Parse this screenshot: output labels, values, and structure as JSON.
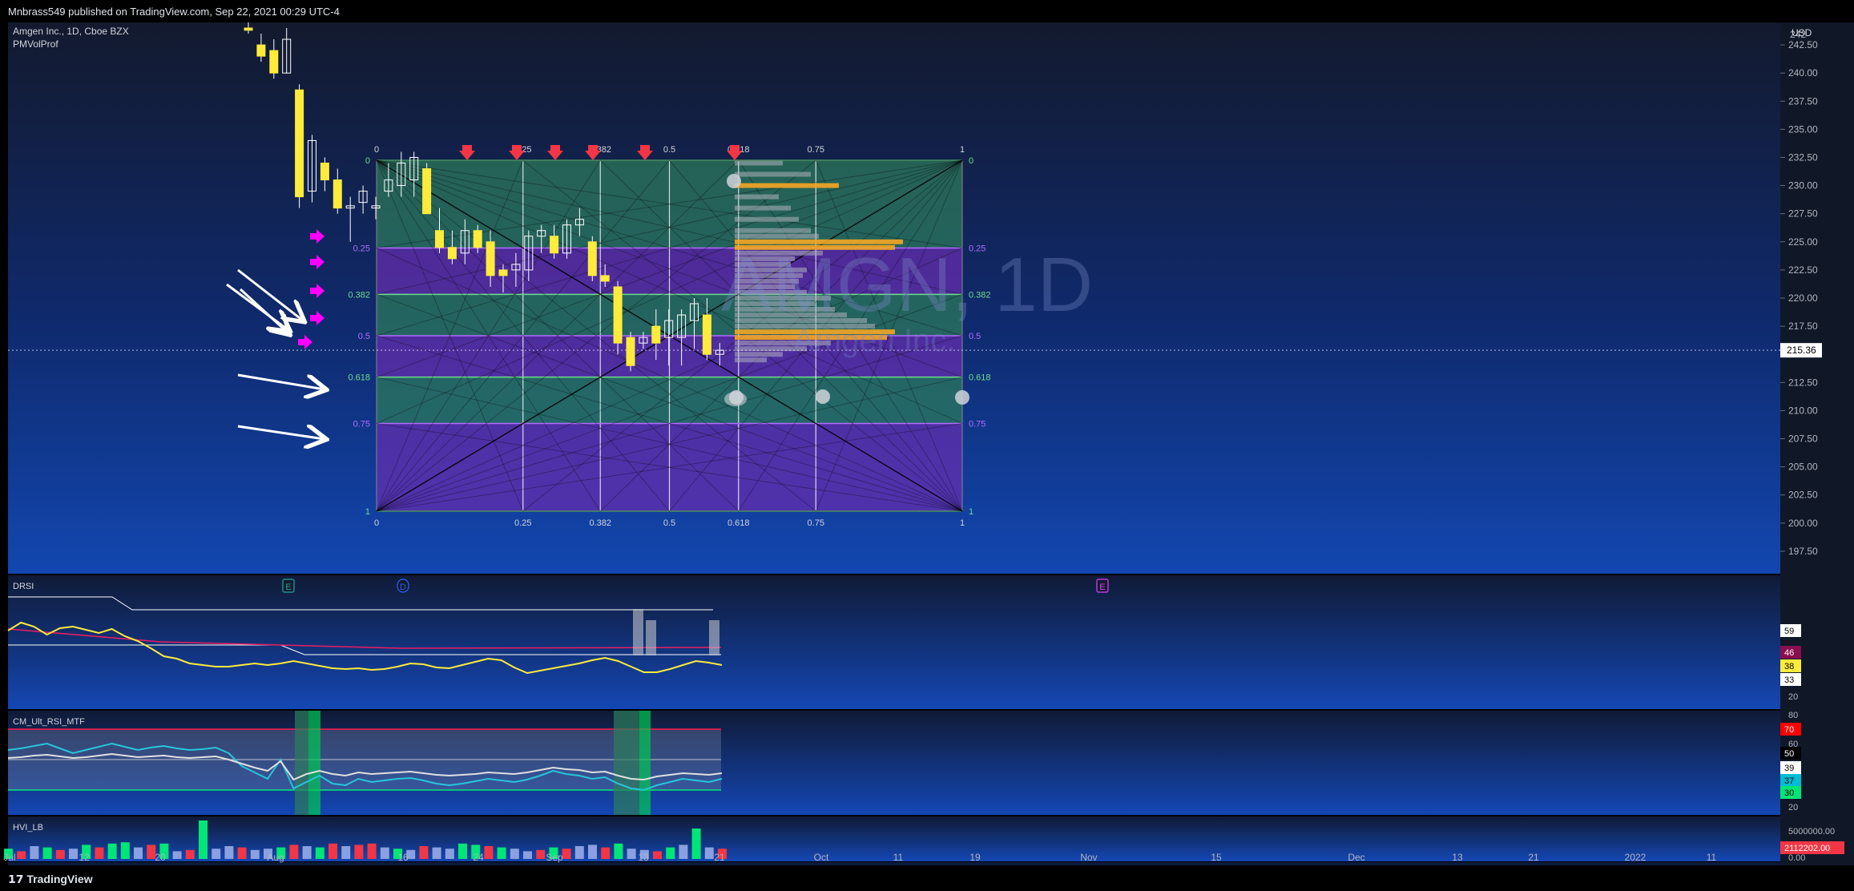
{
  "header": {
    "publish_line": "Mnbrass549 published on TradingView.com, Sep 22, 2021 00:29 UTC-4"
  },
  "symbol": {
    "name": "Amgen Inc., 1D, Cboe BZX",
    "indicator": "PMVolProf",
    "watermark": "AMGN, 1D",
    "watermark_sub": "Amgen Inc.",
    "currency": "USD"
  },
  "footer": {
    "brand": "TradingView"
  },
  "price_axis": {
    "ticks": [
      242.5,
      240.0,
      237.5,
      235.0,
      232.5,
      230.0,
      227.5,
      225.0,
      222.5,
      220.0,
      217.5,
      215.0,
      212.5,
      210.0,
      207.5,
      205.0,
      202.5,
      200.0,
      197.5
    ],
    "top_label": "242",
    "last_price": "215.36"
  },
  "time_axis": {
    "labels": [
      "Jul",
      "12",
      "20",
      "Aug",
      "16",
      "24",
      "Sep",
      "13",
      "21",
      "Oct",
      "11",
      "19",
      "Nov",
      "15",
      "Dec",
      "13",
      "21",
      "2022",
      "11"
    ]
  },
  "events": [
    {
      "label": "E",
      "color": "#26a69a"
    },
    {
      "label": "D",
      "color": "#2962ff"
    },
    {
      "label": "E",
      "color": "#e040fb"
    }
  ],
  "fib": {
    "top_labels": [
      "0",
      "0.25",
      "0.382",
      "0.5",
      "0.618",
      "0.75",
      "1"
    ],
    "bottom_labels": [
      "0",
      "0.25",
      "0.382",
      "0.5",
      "0.618",
      "0.75",
      "1"
    ],
    "left_labels": [
      "0",
      "0.25",
      "0.382",
      "0.5",
      "0.618",
      "0.75",
      "1"
    ],
    "right_labels": [
      "0",
      "0.25",
      "0.382",
      "0.5",
      "0.618",
      "0.75",
      "1"
    ]
  },
  "panes": {
    "drsi": {
      "title": "DRSI",
      "badges": [
        {
          "text": "59",
          "bg": "#ffffff",
          "fg": "#000"
        },
        {
          "text": "46",
          "bg": "#880e4f",
          "fg": "#fff"
        },
        {
          "text": "38",
          "bg": "#ffeb3b",
          "fg": "#000"
        },
        {
          "text": "33",
          "bg": "#ffffff",
          "fg": "#000"
        }
      ],
      "ticks": [
        "20"
      ]
    },
    "rsi": {
      "title": "CM_Ult_RSI_MTF",
      "badges": [
        {
          "text": "70",
          "bg": "#ff0000",
          "fg": "#fff"
        },
        {
          "text": "50",
          "bg": "#000000",
          "fg": "#fff"
        },
        {
          "text": "39",
          "bg": "#ffffff",
          "fg": "#000"
        },
        {
          "text": "37",
          "bg": "#00bcd4",
          "fg": "#000"
        },
        {
          "text": "30",
          "bg": "#00e676",
          "fg": "#000"
        }
      ],
      "ticks": [
        "80",
        "60",
        "20"
      ]
    },
    "hvi": {
      "title": "HVI_LB",
      "badges": [
        {
          "text": "2112202.00",
          "bg": "#f23645",
          "fg": "#fff"
        }
      ],
      "ticks": [
        "5000000.00",
        "0.00"
      ]
    }
  },
  "chart_data": {
    "type": "candlestick",
    "y_range": [
      196.5,
      243.5
    ],
    "candles": [
      {
        "o": 244.0,
        "h": 244.5,
        "l": 243.5,
        "c": 243.8,
        "color": "yellow"
      },
      {
        "o": 242.5,
        "h": 243.5,
        "l": 241.0,
        "c": 241.5,
        "color": "yellow"
      },
      {
        "o": 242.0,
        "h": 243.0,
        "l": 239.5,
        "c": 240.0,
        "color": "yellow"
      },
      {
        "o": 240.0,
        "h": 244.0,
        "l": 240.0,
        "c": 243.0,
        "color": "white"
      },
      {
        "o": 238.5,
        "h": 239.0,
        "l": 228.0,
        "c": 229.0,
        "color": "yellow"
      },
      {
        "o": 229.5,
        "h": 234.5,
        "l": 228.5,
        "c": 234.0,
        "color": "white"
      },
      {
        "o": 232.0,
        "h": 232.5,
        "l": 229.5,
        "c": 230.5,
        "color": "yellow"
      },
      {
        "o": 230.5,
        "h": 231.5,
        "l": 227.5,
        "c": 228.0,
        "color": "yellow"
      },
      {
        "o": 228.0,
        "h": 229.0,
        "l": 225.0,
        "c": 228.2,
        "color": "white"
      },
      {
        "o": 228.5,
        "h": 230.0,
        "l": 227.5,
        "c": 229.5,
        "color": "white"
      },
      {
        "o": 228.0,
        "h": 229.0,
        "l": 227.0,
        "c": 228.2,
        "color": "white"
      },
      {
        "o": 229.5,
        "h": 232.0,
        "l": 229.0,
        "c": 230.5,
        "color": "white"
      },
      {
        "o": 230.0,
        "h": 233.0,
        "l": 229.0,
        "c": 232.0,
        "color": "white"
      },
      {
        "o": 232.5,
        "h": 233.0,
        "l": 229.0,
        "c": 230.5,
        "color": "white"
      },
      {
        "o": 231.5,
        "h": 232.0,
        "l": 227.5,
        "c": 227.5,
        "color": "yellow"
      },
      {
        "o": 226.0,
        "h": 228.0,
        "l": 224.0,
        "c": 224.5,
        "color": "yellow"
      },
      {
        "o": 224.5,
        "h": 226.0,
        "l": 223.0,
        "c": 223.5,
        "color": "yellow"
      },
      {
        "o": 224.0,
        "h": 227.0,
        "l": 223.0,
        "c": 226.0,
        "color": "white"
      },
      {
        "o": 226.0,
        "h": 226.5,
        "l": 224.0,
        "c": 224.5,
        "color": "yellow"
      },
      {
        "o": 225.0,
        "h": 226.0,
        "l": 221.0,
        "c": 222.0,
        "color": "yellow"
      },
      {
        "o": 222.5,
        "h": 223.0,
        "l": 220.5,
        "c": 222.0,
        "color": "yellow"
      },
      {
        "o": 222.5,
        "h": 224.0,
        "l": 221.0,
        "c": 223.0,
        "color": "white"
      },
      {
        "o": 222.5,
        "h": 226.0,
        "l": 221.5,
        "c": 225.5,
        "color": "white"
      },
      {
        "o": 225.5,
        "h": 226.5,
        "l": 224.0,
        "c": 226.0,
        "color": "white"
      },
      {
        "o": 225.5,
        "h": 226.5,
        "l": 223.5,
        "c": 224.0,
        "color": "yellow"
      },
      {
        "o": 224.0,
        "h": 227.0,
        "l": 223.5,
        "c": 226.5,
        "color": "white"
      },
      {
        "o": 226.5,
        "h": 228.0,
        "l": 225.5,
        "c": 227.0,
        "color": "white"
      },
      {
        "o": 225.0,
        "h": 225.5,
        "l": 221.5,
        "c": 222.0,
        "color": "yellow"
      },
      {
        "o": 222.0,
        "h": 223.0,
        "l": 221.0,
        "c": 221.5,
        "color": "yellow"
      },
      {
        "o": 221.0,
        "h": 221.5,
        "l": 215.0,
        "c": 216.0,
        "color": "yellow"
      },
      {
        "o": 216.5,
        "h": 217.0,
        "l": 213.5,
        "c": 214.0,
        "color": "yellow"
      },
      {
        "o": 216.0,
        "h": 217.0,
        "l": 215.5,
        "c": 216.5,
        "color": "white"
      },
      {
        "o": 217.5,
        "h": 219.0,
        "l": 214.5,
        "c": 216.0,
        "color": "yellow"
      },
      {
        "o": 216.5,
        "h": 219.0,
        "l": 214.0,
        "c": 218.0,
        "color": "white"
      },
      {
        "o": 216.5,
        "h": 219.0,
        "l": 214.0,
        "c": 218.5,
        "color": "white"
      },
      {
        "o": 218.0,
        "h": 220.0,
        "l": 215.5,
        "c": 219.5,
        "color": "white"
      },
      {
        "o": 218.5,
        "h": 220.0,
        "l": 214.5,
        "c": 215.0,
        "color": "yellow"
      },
      {
        "o": 215.0,
        "h": 216.0,
        "l": 214.0,
        "c": 215.36,
        "color": "white"
      }
    ]
  }
}
